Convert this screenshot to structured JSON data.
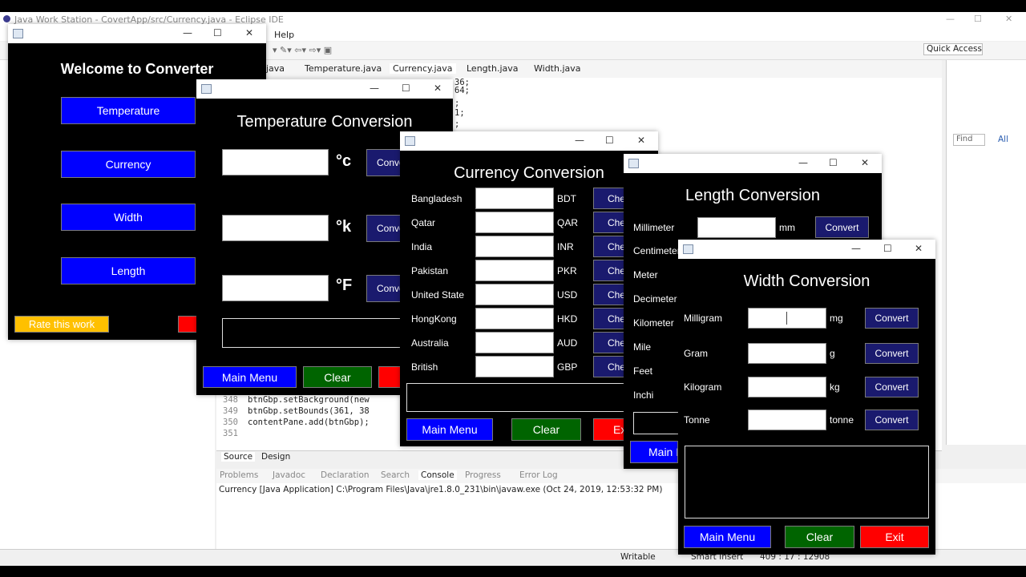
{
  "eclipse": {
    "title": "Java Work Station - CovertApp/src/Currency.java - Eclipse IDE",
    "menu_help": "Help",
    "quick_access": "Quick Access",
    "editor_tabs": [
      "java",
      "Temperature.java",
      "Currency.java",
      "Length.java",
      "Width.java"
    ],
    "code_lines": [
      {
        "n": "348",
        "text": "btnGbp.setBackground(new"
      },
      {
        "n": "349",
        "text": "btnGbp.setBounds(361, 38"
      },
      {
        "n": "350",
        "text": "contentPane.add(btnGbp);"
      },
      {
        "n": "351",
        "text": ""
      }
    ],
    "code_fragments": [
      "36;",
      "64;",
      ";",
      "1;",
      ";"
    ],
    "design_tabs": [
      "Source",
      "Design"
    ],
    "console_tabs": [
      "Problems",
      "Javadoc",
      "Declaration",
      "Search",
      "Console",
      "Progress",
      "Error Log"
    ],
    "console_text": "Currency [Java Application] C:\\Program Files\\Java\\jre1.8.0_231\\bin\\javaw.exe (Oct 24, 2019, 12:53:32 PM)",
    "status_writable": "Writable",
    "status_insert": "Smart Insert",
    "status_pos": "409 : 17 : 12908",
    "outline_find": "Find",
    "outline_all": "All"
  },
  "welcome": {
    "heading": "Welcome to Converter",
    "buttons": [
      "Temperature",
      "Currency",
      "Width",
      "Length"
    ],
    "rate": "Rate this work"
  },
  "temperature": {
    "heading": "Temperature Conversion",
    "units": [
      "°c",
      "°k",
      "°F"
    ],
    "convert": "Conve",
    "main_menu": "Main Menu",
    "clear": "Clear"
  },
  "currency": {
    "heading": "Currency Conversion",
    "rows": [
      {
        "country": "Bangladesh",
        "code": "BDT"
      },
      {
        "country": "Qatar",
        "code": "QAR"
      },
      {
        "country": "India",
        "code": "INR"
      },
      {
        "country": "Pakistan",
        "code": "PKR"
      },
      {
        "country": "United State",
        "code": "USD"
      },
      {
        "country": "HongKong",
        "code": "HKD"
      },
      {
        "country": "Australia",
        "code": "AUD"
      },
      {
        "country": "British",
        "code": "GBP"
      }
    ],
    "check": "Che",
    "main_menu": "Main Menu",
    "clear": "Clear",
    "exit": "Ex"
  },
  "length": {
    "heading": "Length Conversion",
    "labels": [
      "Millimeter",
      "Centimeter",
      "Meter",
      "Decimeter",
      "Kilometer",
      "Mile",
      "Feet",
      "Inchi"
    ],
    "first_unit": "mm",
    "convert": "Convert",
    "main_menu": "Main M"
  },
  "width": {
    "heading": "Width Conversion",
    "rows": [
      {
        "label": "Milligram",
        "unit": "mg"
      },
      {
        "label": "Gram",
        "unit": "g"
      },
      {
        "label": "Kilogram",
        "unit": "kg"
      },
      {
        "label": "Tonne",
        "unit": "tonne"
      }
    ],
    "convert": "Convert",
    "main_menu": "Main Menu",
    "clear": "Clear",
    "exit": "Exit"
  }
}
